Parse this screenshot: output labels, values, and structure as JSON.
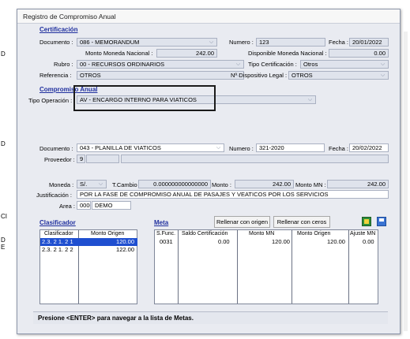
{
  "window": {
    "title": "Registro de Compromiso Anual"
  },
  "left_margin": [
    "D",
    "D",
    "CI",
    "D",
    "E"
  ],
  "certificacion": {
    "section_label": "Certificación",
    "documento_label": "Documento :",
    "documento_value": "086 - MEMORANDUM",
    "numero_label": "Numero :",
    "numero_value": "123",
    "fecha_label": "Fecha :",
    "fecha_value": "20/01/2022",
    "monto_nacional_label": "Monto Moneda Nacional :",
    "monto_nacional_value": "242.00",
    "disponible_label": "Disponible Moneda Nacional :",
    "disponible_value": "0.00",
    "rubro_label": "Rubro :",
    "rubro_value": "00 - RECURSOS ORDINARIOS",
    "tipo_cert_label": "Tipo Certificación :",
    "tipo_cert_value": "Otros",
    "referencia_label": "Referencia :",
    "referencia_value": "OTROS",
    "dispositivo_label": "Nº Dispositivo Legal :",
    "dispositivo_value": "OTROS"
  },
  "compromiso": {
    "section_label": "Compromiso Anual",
    "tipo_operacion_label": "Tipo Operación :",
    "tipo_operacion_value": "AV - ENCARGO INTERNO PARA VIATICOS",
    "documento_label": "Documento :",
    "documento_value": "043 - PLANILLA DE VIATICOS",
    "numero_label": "Numero :",
    "numero_value": "321-2020",
    "fecha_label": "Fecha :",
    "fecha_value": "20/02/2022",
    "proveedor_label": "Proveedor :",
    "proveedor_value": "9",
    "moneda_label": "Moneda :",
    "moneda_value": "S/.",
    "tcambio_label": "T.Cambio :",
    "tcambio_value": "0.000000000000000",
    "monto_label": "Monto :",
    "monto_value": "242.00",
    "monto_mn_label": "Monto MN :",
    "monto_mn_value": "242.00",
    "justificacion_label": "Justificación :",
    "justificacion_value": "POR LA FASE DE COMPROMISO ANUAL DE PASAJES Y VEATICOS POR LOS SERVICIOS",
    "area_label": "Area :",
    "area_code": "0000",
    "area_name": "DEMO"
  },
  "clasificador": {
    "section_label": "Clasificador",
    "headers": [
      "Clasificador",
      "Monto Origen"
    ],
    "rows": [
      [
        "2.3. 2 1. 2 1",
        "120.00"
      ],
      [
        "2.3. 2 1. 2 2",
        "122.00"
      ]
    ]
  },
  "meta": {
    "section_label": "Meta",
    "rellenar_origen": "Rellenar con origen",
    "rellenar_ceros": "Rellenar con ceros",
    "headers": [
      "S.Func.",
      "Saldo Certificación",
      "Monto MN",
      "Monto Origen",
      "Ajuste MN"
    ],
    "rows": [
      [
        "0031",
        "0.00",
        "120.00",
        "120.00",
        "0.00"
      ]
    ]
  },
  "status": {
    "text": "Presione <ENTER> para navegar a la lista de Metas."
  },
  "icons": {
    "export": "excel-icon",
    "save": "save-icon",
    "dropdown": "chevron-down-icon"
  },
  "colors": {
    "section_title": "#1f2f9e",
    "selection": "#1f4fd0",
    "window_bg": "#e9ebf1"
  }
}
